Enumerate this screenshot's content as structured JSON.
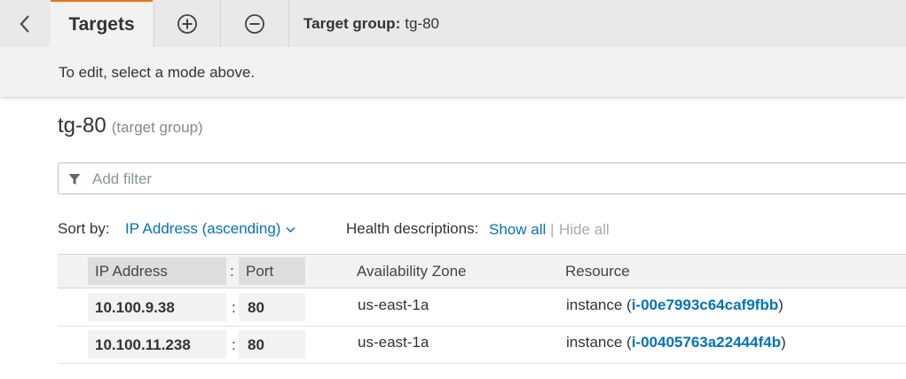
{
  "tabs": {
    "active_label": "Targets",
    "group_label": "Target group:",
    "group_name": "tg-80"
  },
  "mode_hint": "To edit, select a mode above.",
  "title": {
    "name": "tg-80",
    "subtitle": "(target group)"
  },
  "filter": {
    "placeholder": "Add filter",
    "value": ""
  },
  "sort": {
    "label": "Sort by:",
    "selected": "IP Address (ascending)"
  },
  "health": {
    "label": "Health descriptions:",
    "show_all": "Show all",
    "separator": "|",
    "hide_all": "Hide all"
  },
  "table": {
    "headers": {
      "ip": "IP Address",
      "colon": ":",
      "port": "Port",
      "az": "Availability Zone",
      "resource": "Resource"
    },
    "rows": [
      {
        "ip": "10.100.9.38",
        "colon": ":",
        "port": "80",
        "az": "us-east-1a",
        "resource_prefix": "instance (",
        "resource_id": "i-00e7993c64caf9fbb",
        "resource_suffix": ")"
      },
      {
        "ip": "10.100.11.238",
        "colon": ":",
        "port": "80",
        "az": "us-east-1a",
        "resource_prefix": "instance (",
        "resource_id": "i-00405763a22444f4b",
        "resource_suffix": ")"
      }
    ]
  },
  "icons": {
    "back": "chevron-left-icon",
    "add": "plus-circle-icon",
    "remove": "minus-circle-icon",
    "filter": "filter-icon",
    "dropdown": "chevron-down-icon"
  },
  "colors": {
    "accent_link": "#0073bb",
    "active_tab_border": "#ec7211",
    "bar_bg": "#e9e9e9"
  }
}
